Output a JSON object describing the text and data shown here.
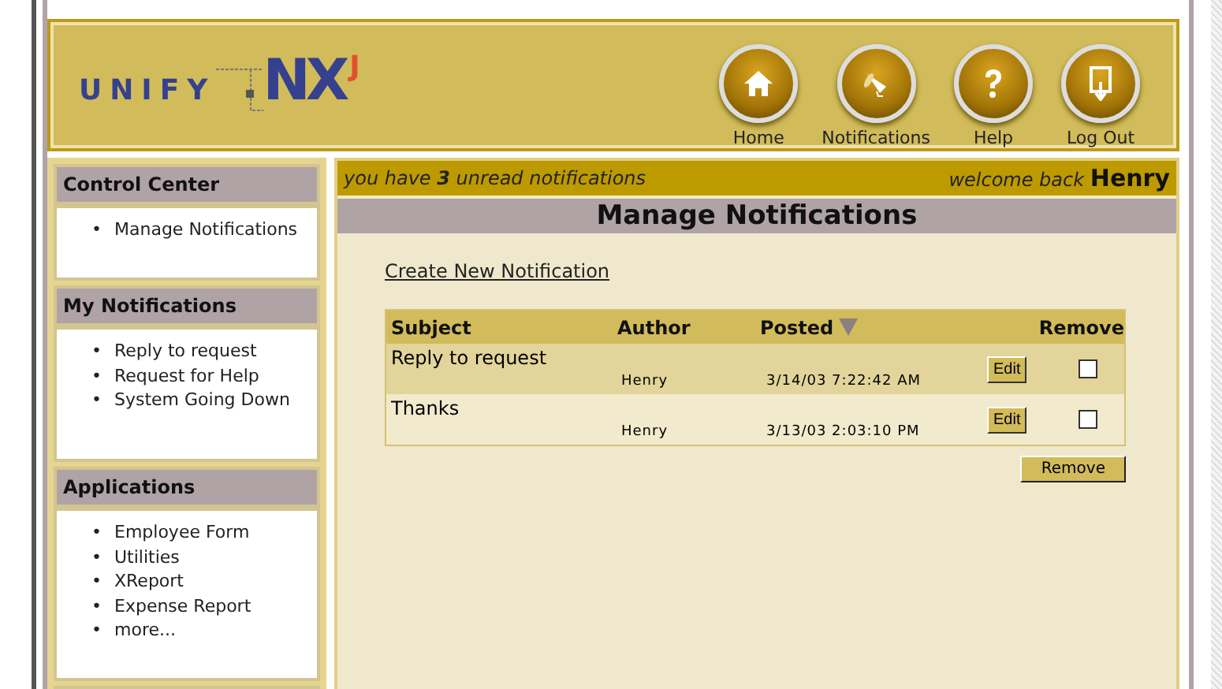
{
  "logo": {
    "word": "UNIFY",
    "mark": "NX",
    "superscript": "J"
  },
  "nav": [
    {
      "label": "Home",
      "kind": "home"
    },
    {
      "label": "Notifications",
      "kind": "megaphone"
    },
    {
      "label": "Help",
      "kind": "help"
    },
    {
      "label": "Log Out",
      "kind": "logout"
    }
  ],
  "bullet": "•",
  "sidebar": [
    {
      "kind": "list",
      "title": "Control Center",
      "items": [
        "Manage Notifications"
      ]
    },
    {
      "kind": "list",
      "title": "My Notifications",
      "items": [
        "Reply to request",
        "Request for Help",
        "System Going Down"
      ]
    },
    {
      "kind": "list",
      "title": "Applications",
      "items": [
        "Employee Form",
        "Utilities",
        "XReport",
        "Expense Report",
        "more..."
      ]
    },
    {
      "kind": "header_only"
    }
  ],
  "status_bar": {
    "message": "you have **3** unread notifications",
    "greeting": "welcome back",
    "user": "Henry"
  },
  "page_title": "Manage Notifications",
  "create_link": "Create New Notification",
  "table": {
    "columns": [
      "Subject",
      "Author",
      "Posted",
      "Remove"
    ],
    "rows": [
      {
        "subject": "Reply to request",
        "author": "Henry",
        "posted": "3/14/03 7:22:42 AM",
        "edit": "Edit",
        "checked": false,
        "highlighted": true
      },
      {
        "subject": "Thanks",
        "author": "Henry",
        "posted": "3/13/03 2:03:10 PM",
        "edit": "Edit",
        "checked": false,
        "highlighted": false
      }
    ]
  },
  "remove_button": "Remove"
}
